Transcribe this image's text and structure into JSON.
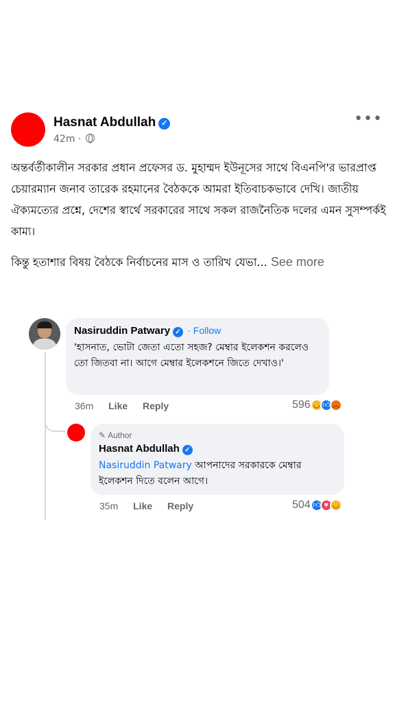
{
  "post": {
    "author": "Hasnat Abdullah",
    "time": "42m",
    "separator": "·",
    "more_label": "•••",
    "paragraph1": "অন্তর্বর্তীকালীন সরকার প্রধান প্রফেসর ড. মুহাম্মদ ইউনূসের সাথে বিএনপি'র ভারপ্রাপ্ত চেয়ারম্যান জনাব তারেক রহমানের বৈঠককে আমরা ইতিবাচকভাবে দেখি। জাতীয় ঐক্যমত্যের প্রশ্নে, দেশের স্বার্থে সরকারের সাথে সকল রাজনৈতিক দলের এমন সুসম্পর্কই কাম্য।",
    "paragraph2": "কিন্তু হতাশার বিষয় বৈঠকে নির্বাচনের মাস ও তারিখ যেভা...",
    "see_more": "See more"
  },
  "comments": [
    {
      "author": "Nasiruddin Patwary",
      "follow": "· Follow",
      "text": "'হাসনাত, ভোটা জেতা এতো সহজ? মেম্বার ইলেকশন করলেও তো জিতবা না। আগে মেম্বার ইলেকশনে জিতে দেখাও।'",
      "time": "36m",
      "like": "Like",
      "reply": "Reply",
      "reaction_count": "596",
      "reactions": [
        "haha-icon",
        "like-icon",
        "angry-icon"
      ]
    },
    {
      "badge": "Author",
      "author": "Hasnat Abdullah",
      "mention": "Nasiruddin Patwary",
      "text": " আপনাদের সরকারকে মেম্বার ইলেকশন দিতে বলেন আগে।",
      "time": "35m",
      "like": "Like",
      "reply": "Reply",
      "reaction_count": "504",
      "reactions": [
        "like-icon",
        "love-icon",
        "haha-icon"
      ]
    }
  ],
  "colors": {
    "accent": "#1877f2",
    "avatar_red": "#ff0000",
    "muted": "#65676b",
    "bubble": "#f0f2f5"
  }
}
